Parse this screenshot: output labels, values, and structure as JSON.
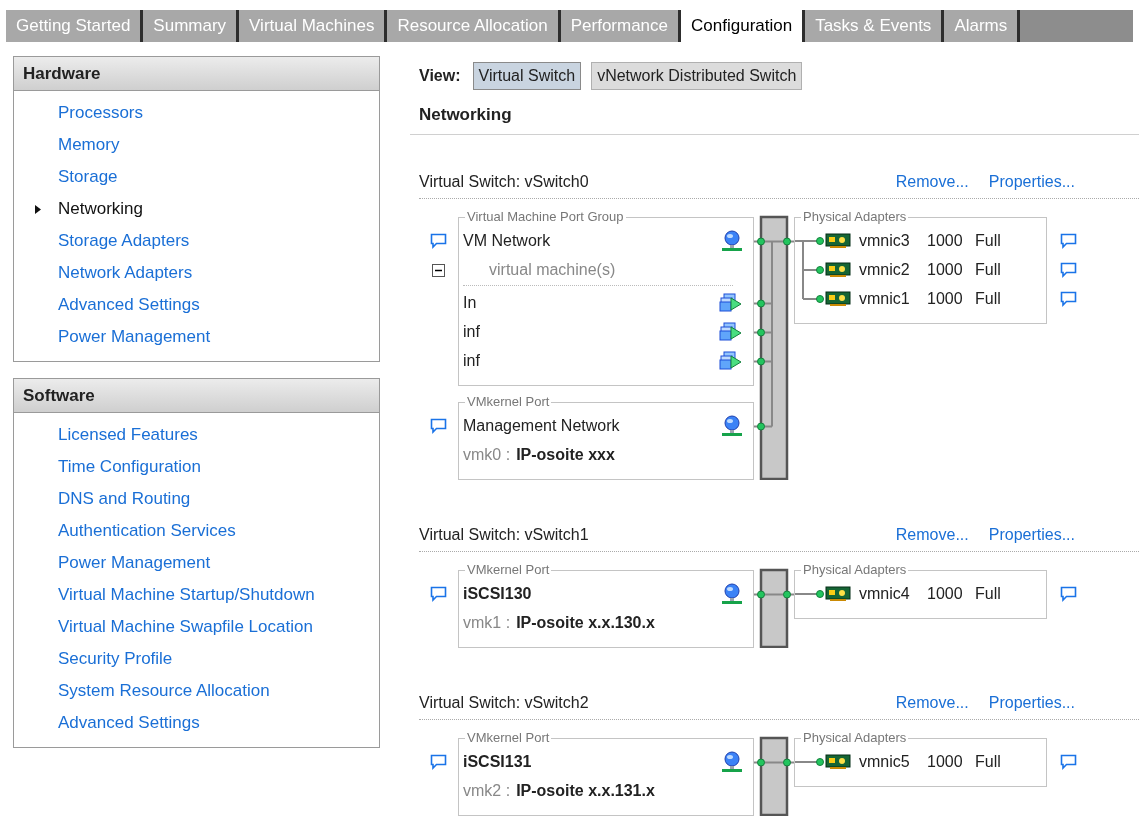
{
  "tabs": [
    {
      "label": "Getting Started",
      "selected": false
    },
    {
      "label": "Summary",
      "selected": false
    },
    {
      "label": "Virtual Machines",
      "selected": false
    },
    {
      "label": "Resource Allocation",
      "selected": false
    },
    {
      "label": "Performance",
      "selected": false
    },
    {
      "label": "Configuration",
      "selected": true
    },
    {
      "label": "Tasks & Events",
      "selected": false
    },
    {
      "label": "Alarms",
      "selected": false
    }
  ],
  "sidebar": {
    "panels": [
      {
        "title": "Hardware",
        "items": [
          {
            "label": "Processors",
            "selected": false
          },
          {
            "label": "Memory",
            "selected": false
          },
          {
            "label": "Storage",
            "selected": false
          },
          {
            "label": "Networking",
            "selected": true
          },
          {
            "label": "Storage Adapters",
            "selected": false
          },
          {
            "label": "Network Adapters",
            "selected": false
          },
          {
            "label": "Advanced Settings",
            "selected": false
          },
          {
            "label": "Power Management",
            "selected": false
          }
        ]
      },
      {
        "title": "Software",
        "items": [
          {
            "label": "Licensed Features",
            "selected": false
          },
          {
            "label": "Time Configuration",
            "selected": false
          },
          {
            "label": "DNS and Routing",
            "selected": false
          },
          {
            "label": "Authentication Services",
            "selected": false
          },
          {
            "label": "Power Management",
            "selected": false
          },
          {
            "label": "Virtual Machine Startup/Shutdown",
            "selected": false
          },
          {
            "label": "Virtual Machine Swapfile Location",
            "selected": false
          },
          {
            "label": "Security Profile",
            "selected": false
          },
          {
            "label": "System Resource Allocation",
            "selected": false
          },
          {
            "label": "Advanced Settings",
            "selected": false
          }
        ]
      }
    ]
  },
  "view": {
    "label": "View:",
    "options": [
      {
        "label": "Virtual Switch",
        "selected": true
      },
      {
        "label": "vNetwork Distributed Switch",
        "selected": false
      }
    ]
  },
  "section_title": "Networking",
  "switches": [
    {
      "title": "Virtual Switch: vSwitch0",
      "actions": [
        "Remove...",
        "Properties..."
      ],
      "port_groups": [
        {
          "kind": "vm",
          "legend": "Virtual Machine Port Group",
          "name": "VM Network",
          "bold": false,
          "vm_count_label": "virtual machine(s)",
          "expanded": true,
          "vms": [
            "In",
            "inf",
            "inf"
          ]
        },
        {
          "kind": "vmkernel",
          "legend": "VMkernel Port",
          "name": "Management Network",
          "bold": false,
          "vmk": "vmk0 :",
          "ip": "IP-osoite xxx"
        }
      ],
      "adapters": {
        "legend": "Physical Adapters",
        "items": [
          {
            "name": "vmnic3",
            "speed": "1000",
            "duplex": "Full"
          },
          {
            "name": "vmnic2",
            "speed": "1000",
            "duplex": "Full"
          },
          {
            "name": "vmnic1",
            "speed": "1000",
            "duplex": "Full"
          }
        ]
      }
    },
    {
      "title": "Virtual Switch: vSwitch1",
      "actions": [
        "Remove...",
        "Properties..."
      ],
      "port_groups": [
        {
          "kind": "vmkernel",
          "legend": "VMkernel Port",
          "name": "iSCSI130",
          "bold": true,
          "vmk": "vmk1 :",
          "ip": "IP-osoite x.x.130.x"
        }
      ],
      "adapters": {
        "legend": "Physical Adapters",
        "items": [
          {
            "name": "vmnic4",
            "speed": "1000",
            "duplex": "Full"
          }
        ]
      }
    },
    {
      "title": "Virtual Switch: vSwitch2",
      "actions": [
        "Remove...",
        "Properties..."
      ],
      "port_groups": [
        {
          "kind": "vmkernel",
          "legend": "VMkernel Port",
          "name": "iSCSI131",
          "bold": true,
          "vmk": "vmk2 :",
          "ip": "IP-osoite x.x.131.x"
        }
      ],
      "adapters": {
        "legend": "Physical Adapters",
        "items": [
          {
            "name": "vmnic5",
            "speed": "1000",
            "duplex": "Full"
          }
        ]
      }
    }
  ]
}
